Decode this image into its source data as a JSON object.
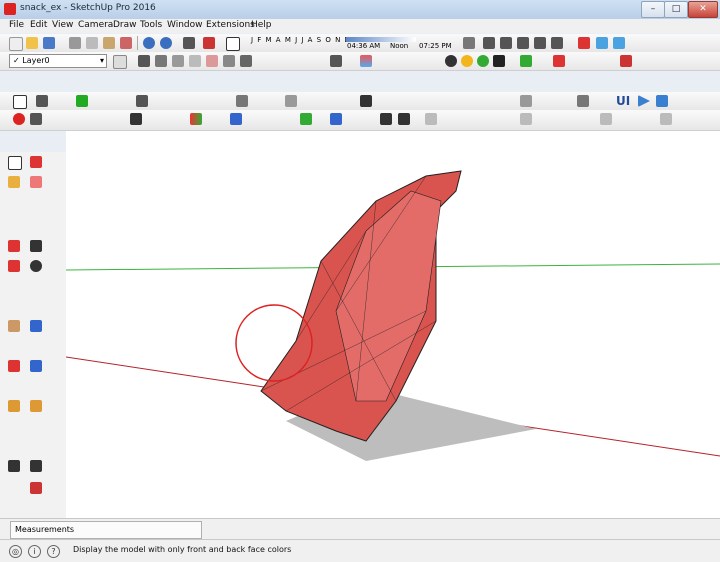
{
  "window": {
    "title": "snack_ex - SketchUp Pro 2016",
    "minimize_glyph": "–",
    "maximize_glyph": "□",
    "close_glyph": "✕"
  },
  "menu": [
    "File",
    "Edit",
    "View",
    "Camera",
    "Draw",
    "Tools",
    "Window",
    "Extensions",
    "Help"
  ],
  "toolbar": {
    "layer_value": "Layer0",
    "months_text": "J F M A M J J A S O N D",
    "time_left": "04:36 AM",
    "time_noon": "Noon",
    "time_right": "07:25 PM",
    "ui_text": "UI"
  },
  "measurements": {
    "label": "Measurements"
  },
  "status": {
    "message": "Display the model with only front and back face colors"
  },
  "colors": {
    "accent_red": "#d23b3b",
    "model_face": "#d9534f",
    "axis_green": "#3cb43c",
    "axis_red": "#b4232a",
    "axis_blue": "#2244aa"
  },
  "icons": [
    "new-icon",
    "open-icon",
    "save-icon",
    "cut-icon",
    "copy-icon",
    "paste-icon",
    "erase-icon",
    "undo-icon",
    "redo-icon",
    "print-icon",
    "model-info-icon",
    "select-icon",
    "paint-icon",
    "eraser-icon",
    "line-icon",
    "rectangle-icon",
    "circle-icon",
    "move-icon",
    "rotate-icon",
    "scale-icon",
    "orbit-icon",
    "pan-icon",
    "zoom-icon",
    "xray-icon",
    "wireframe-icon",
    "hidden-line-icon",
    "shaded-icon",
    "textured-icon",
    "monochrome-icon"
  ]
}
